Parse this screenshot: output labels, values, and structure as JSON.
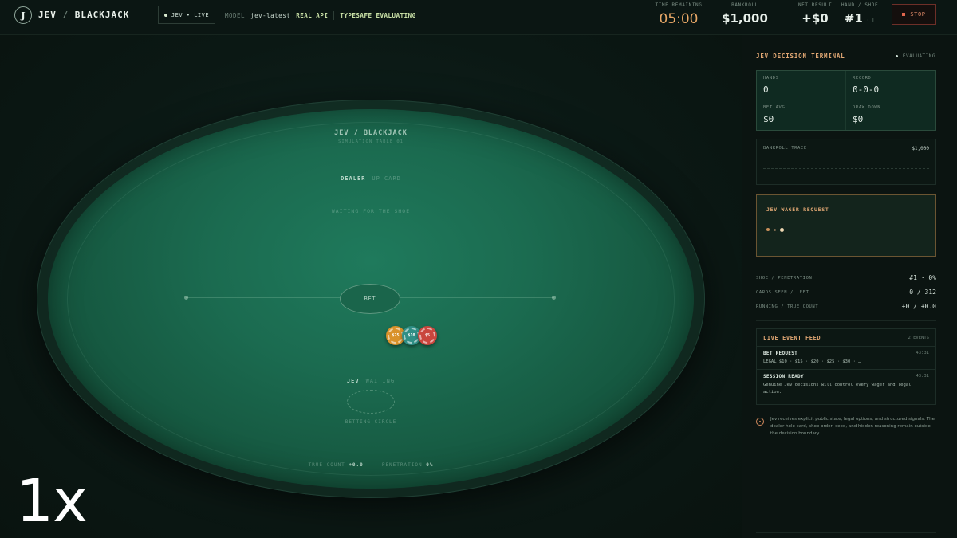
{
  "header": {
    "logo_letter": "J",
    "brand_primary": "JEV",
    "brand_slash": "/",
    "brand_secondary": "BLACKJACK",
    "live_label": "JEV • LIVE",
    "model_label": "MODEL",
    "model_value": "jev-latest",
    "api_label": "REAL API",
    "status_label": "TYPESAFE EVALUATING",
    "time_label": "TIME REMAINING",
    "time_value": "05:00",
    "bankroll_label": "BANKROLL",
    "bankroll_value": "$1,000",
    "net_label": "NET RESULT",
    "net_value": "+$0",
    "hand_label": "HAND / SHOE",
    "hand_value": "#1",
    "shoe_value": "1",
    "stop_label": "STOP"
  },
  "table": {
    "title": "JEV / BLACKJACK",
    "subtitle": "SIMULATION TABLE 01",
    "dealer_label": "DEALER",
    "dealer_status": "UP CARD",
    "waiting_text": "WAITING FOR THE SHOE",
    "bet_label": "BET",
    "chips": [
      {
        "label": "$25",
        "color": "#d9922a"
      },
      {
        "label": "$10",
        "color": "#2f8f86"
      },
      {
        "label": "$5",
        "color": "#c9463d"
      }
    ],
    "player_label": "JEV",
    "player_status": "WAITING",
    "betting_circle_label": "BETTING CIRCLE",
    "true_count_label": "TRUE COUNT",
    "true_count_value": "+0.0",
    "penetration_label": "PENETRATION",
    "penetration_value": "0%"
  },
  "overlay": {
    "speed": "1x"
  },
  "sidebar": {
    "title": "JEV DECISION TERMINAL",
    "status": "EVALUATING",
    "stats": [
      {
        "label": "HANDS",
        "value": "0"
      },
      {
        "label": "RECORD",
        "value": "0-0-0"
      },
      {
        "label": "BET AVG",
        "value": "$0"
      },
      {
        "label": "DRAW DOWN",
        "value": "$0"
      }
    ],
    "trace_label": "BANKROLL TRACE",
    "trace_value": "$1,000",
    "wager_title": "JEV WAGER REQUEST",
    "shoe_label": "SHOE / PENETRATION",
    "shoe_value": "#1 · 0%",
    "cards_label": "CARDS SEEN / LEFT",
    "cards_value": "0 / 312",
    "count_label": "RUNNING / TRUE COUNT",
    "count_value": "+0 / +0.0",
    "feed_title": "LIVE EVENT FEED",
    "feed_count": "2 EVENTS",
    "events": [
      {
        "title": "BET REQUEST",
        "time": "43:31",
        "detail": "LEGAL $10 · $15 · $20 · $25 · $30 · …"
      },
      {
        "title": "SESSION READY",
        "time": "43:31",
        "detail": "Genuine Jev decisions will control every wager and legal action."
      }
    ],
    "note": "Jev receives explicit public state, legal options, and structured signals. The dealer hole card, shoe order, seed, and hidden reasoning remain outside the decision boundary."
  }
}
